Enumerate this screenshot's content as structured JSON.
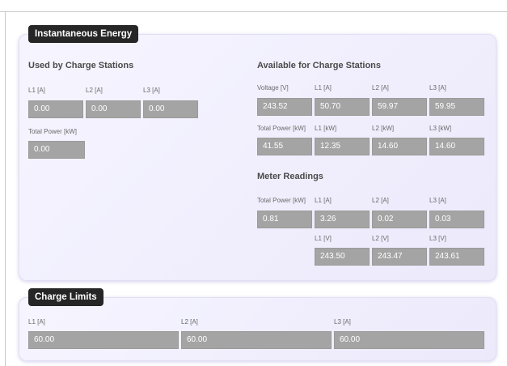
{
  "energy": {
    "tag": "Instantaneous Energy",
    "used": {
      "title": "Used by Charge Stations",
      "current_labels": [
        "L1 [A]",
        "L2 [A]",
        "L3 [A]"
      ],
      "current_values": [
        "0.00",
        "0.00",
        "0.00"
      ],
      "power_label": "Total Power [kW]",
      "power_value": "0.00"
    },
    "available": {
      "title": "Available for Charge Stations",
      "row1_labels": [
        "Voltage [V]",
        "L1 [A]",
        "L2 [A]",
        "L3 [A]"
      ],
      "row1_values": [
        "243.52",
        "50.70",
        "59.97",
        "59.95"
      ],
      "row2_labels": [
        "Total Power [kW]",
        "L1 [kW]",
        "L2 [kW]",
        "L3 [kW]"
      ],
      "row2_values": [
        "41.55",
        "12.35",
        "14.60",
        "14.60"
      ]
    },
    "meter": {
      "title": "Meter Readings",
      "row1_labels": [
        "Total Power [kW]",
        "L1 [A]",
        "L2 [A]",
        "L3 [A]"
      ],
      "row1_values": [
        "0.81",
        "3.26",
        "0.02",
        "0.03"
      ],
      "row2_labels": [
        "L1 [V]",
        "L2 [V]",
        "L3 [V]"
      ],
      "row2_values": [
        "243.50",
        "243.47",
        "243.61"
      ]
    }
  },
  "limits": {
    "tag": "Charge Limits",
    "labels": [
      "L1 [A]",
      "L2 [A]",
      "L3 [A]"
    ],
    "values": [
      "60.00",
      "60.00",
      "60.00"
    ]
  }
}
